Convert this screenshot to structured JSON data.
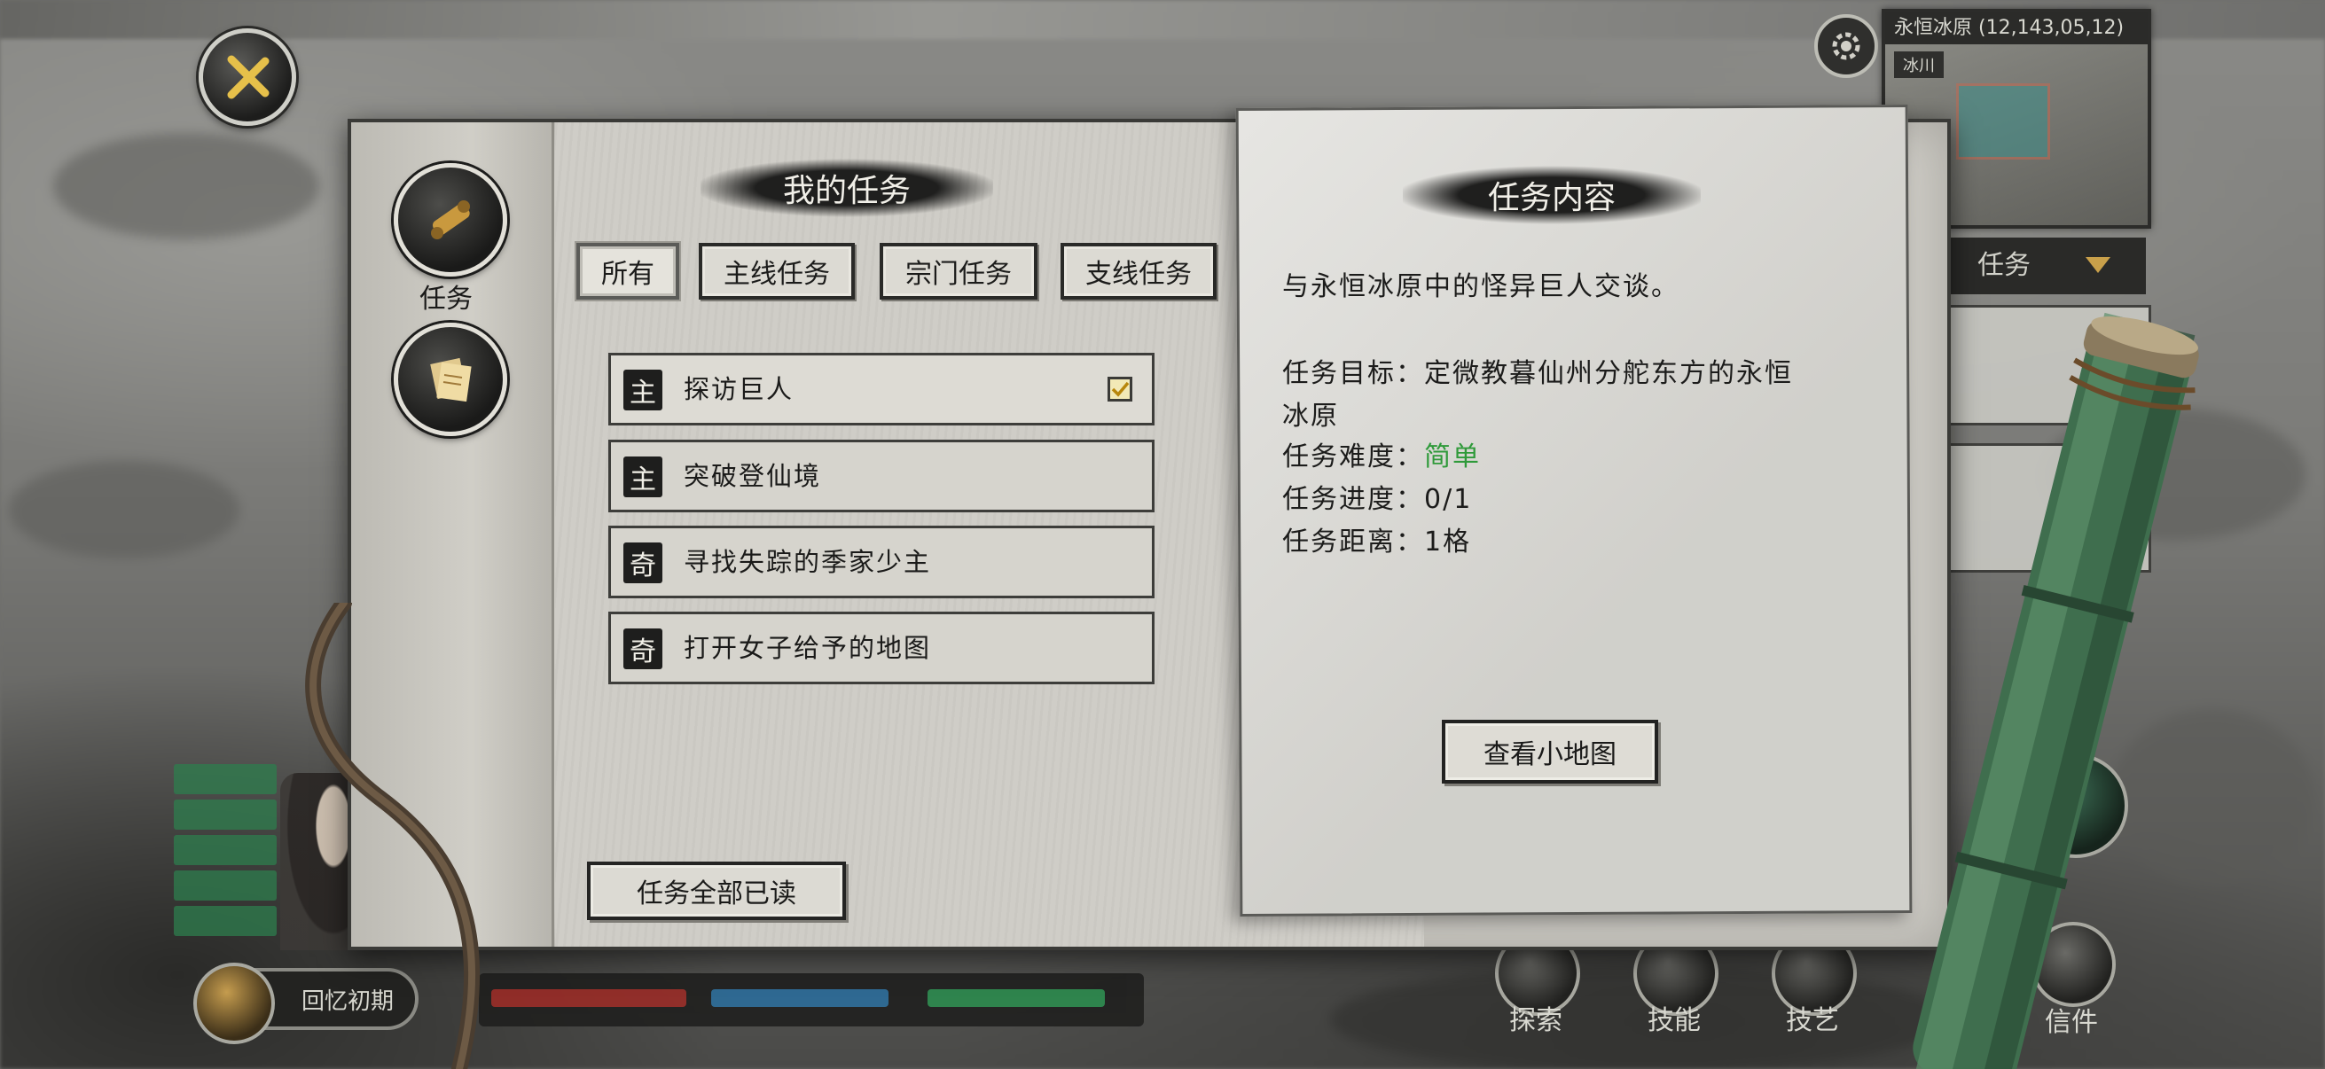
{
  "hud": {
    "minimap_title": "永恒冰原 (12,143,05,12)",
    "minimap_sub": "冰川",
    "quest_tab_label": "任务",
    "player_name": "回忆初期",
    "bottom_actions": [
      "探索",
      "技能",
      "技艺",
      "信件"
    ]
  },
  "sidebar": {
    "categories": [
      {
        "label": "任务",
        "icon": "scroll-icon"
      },
      {
        "label": "",
        "icon": "letters-icon"
      }
    ]
  },
  "quest_list": {
    "title": "我的任务",
    "tabs": [
      "所有",
      "主线任务",
      "宗门任务",
      "支线任务"
    ],
    "active_tab": "所有",
    "items": [
      {
        "badge": "主",
        "name": "探访巨人",
        "checked": true
      },
      {
        "badge": "主",
        "name": "突破登仙境",
        "checked": false
      },
      {
        "badge": "奇",
        "name": "寻找失踪的季家少主",
        "checked": false
      },
      {
        "badge": "奇",
        "name": "打开女子给予的地图",
        "checked": false
      }
    ],
    "read_all_label": "任务全部已读"
  },
  "quest_detail": {
    "title": "任务内容",
    "description": "与永恒冰原中的怪异巨人交谈。",
    "objective_label": "任务目标：",
    "objective_line1": "定微教暮仙州分舵东方的永恒",
    "objective_line2": "冰原",
    "difficulty_label": "任务难度：",
    "difficulty_value": "简单",
    "progress_label": "任务进度：",
    "progress_value": "0/1",
    "distance_label": "任务距离：",
    "distance_value": "1格",
    "view_map_label": "查看小地图"
  },
  "colors": {
    "difficulty_easy": "#2f9a3a",
    "paper": "#cfcdc7",
    "ink": "#1e1e1d"
  }
}
